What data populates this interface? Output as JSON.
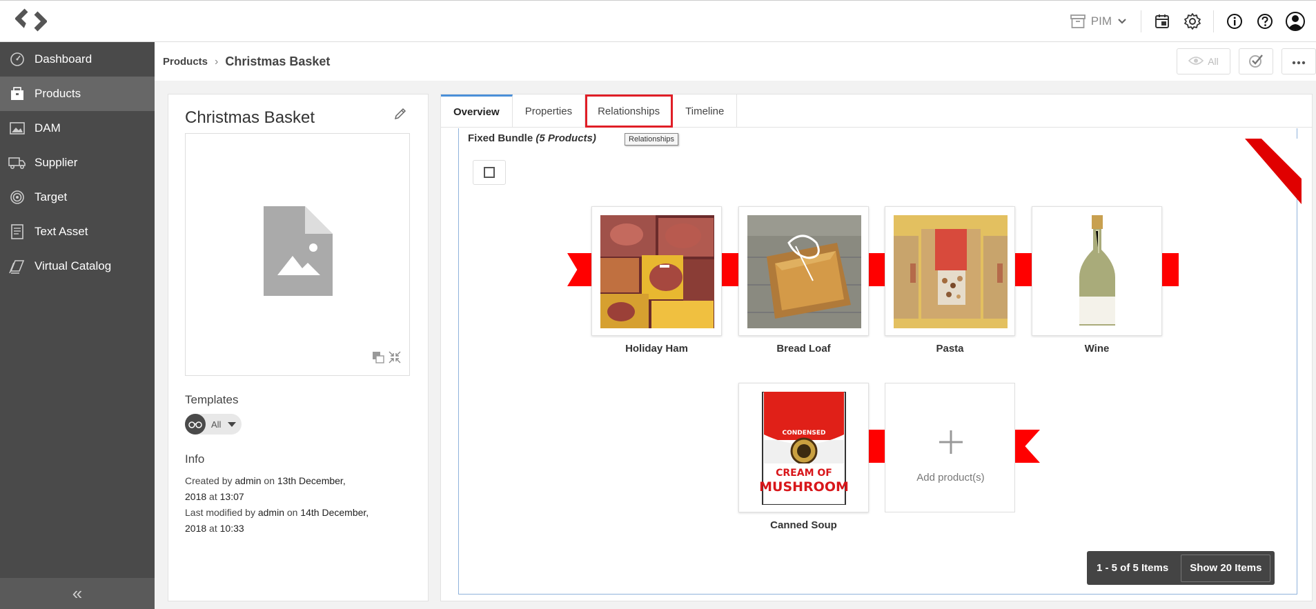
{
  "topbar": {
    "logo_icon": "logo-icon",
    "app_switcher_label": "PIM",
    "icons": [
      "archive-icon",
      "calendar-icon",
      "gear-icon",
      "info-icon",
      "help-icon",
      "user-icon"
    ]
  },
  "sidebar": {
    "items": [
      {
        "label": "Dashboard",
        "icon": "dashboard-icon"
      },
      {
        "label": "Products",
        "icon": "products-icon",
        "active": true
      },
      {
        "label": "DAM",
        "icon": "image-icon"
      },
      {
        "label": "Supplier",
        "icon": "truck-icon"
      },
      {
        "label": "Target",
        "icon": "target-icon"
      },
      {
        "label": "Text Asset",
        "icon": "document-icon"
      },
      {
        "label": "Virtual Catalog",
        "icon": "catalog-icon"
      }
    ],
    "collapse_label": "«"
  },
  "breadcrumb": {
    "parent": "Products",
    "separator": "›",
    "current": "Christmas Basket"
  },
  "header_actions": {
    "view_all_label": "All"
  },
  "product": {
    "title": "Christmas Basket",
    "templates_heading": "Templates",
    "template_value": "All",
    "info_heading": "Info",
    "created_prefix": "Created by",
    "created_by": "admin",
    "created_on_word": "on",
    "created_date": "13th December,",
    "created_date2": "2018",
    "created_at_word": "at",
    "created_time": "13:07",
    "modified_prefix": "Last modified by",
    "modified_by": "admin",
    "modified_on_word": "on",
    "modified_date": "14th December,",
    "modified_date2": "2018",
    "modified_at_word": "at",
    "modified_time": "10:33"
  },
  "tabs": [
    {
      "label": "Overview",
      "active": true
    },
    {
      "label": "Properties"
    },
    {
      "label": "Relationships",
      "highlighted": true
    },
    {
      "label": "Timeline"
    }
  ],
  "tooltip": "Relationships",
  "bundle": {
    "title": "Fixed Bundle",
    "count_label": "(5 Products)",
    "products": [
      {
        "name": "Holiday Ham"
      },
      {
        "name": "Bread Loaf"
      },
      {
        "name": "Pasta"
      },
      {
        "name": "Wine"
      },
      {
        "name": "Canned Soup"
      }
    ],
    "add_label": "Add product(s)",
    "soup_label_top": "CONDENSED",
    "soup_label_mid": "CREAM OF",
    "soup_label_bottom": "MUSHROOM"
  },
  "pager": {
    "range": "1 - 5 of 5 Items",
    "show": "Show 20 Items"
  },
  "colors": {
    "sidebar_bg": "#4a4a4a",
    "sidebar_active": "#676767",
    "ribbon_red": "#ff0000",
    "highlight_red": "#e01e26",
    "tab_active_blue": "#4a8fd8"
  }
}
